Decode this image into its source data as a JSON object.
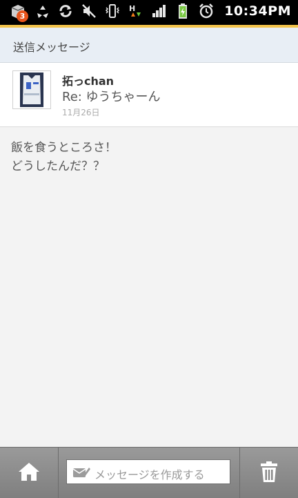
{
  "status_bar": {
    "notification_count": "3",
    "time": "10:34PM",
    "icons": [
      "app-notification-icon",
      "recycle-icon",
      "sync-icon",
      "mute-icon",
      "vibrate-icon",
      "network-h-icon",
      "signal-icon",
      "battery-icon",
      "alarm-icon"
    ]
  },
  "header": {
    "title": "送信メッセージ"
  },
  "message": {
    "sender": "拓っchan",
    "subject": "Re: ゆうちゃーん",
    "date": "11月26日",
    "body_line1": "飯を食うところさ！",
    "body_line2": "どうしたんだ？？"
  },
  "bottom_bar": {
    "compose_placeholder": "メッセージを作成する"
  },
  "colors": {
    "accent": "#f3c34a",
    "header_bg": "#e8eef5",
    "bottom_bar": "#8c8c8c"
  }
}
